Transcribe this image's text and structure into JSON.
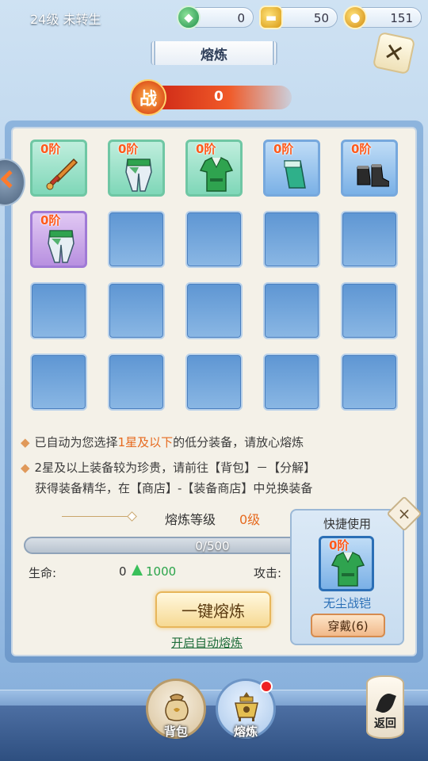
{
  "header": {
    "level_text": "24级 未转生",
    "resources": [
      {
        "icon": "jade-icon",
        "value": "0"
      },
      {
        "icon": "gold-ingot-icon",
        "value": "50"
      },
      {
        "icon": "coin-icon",
        "value": "151"
      }
    ],
    "title": "熔炼",
    "power_icon_text": "战",
    "power_value": "0"
  },
  "grid": {
    "slots": [
      {
        "state": "green",
        "tier": "0阶",
        "item": "sword-icon"
      },
      {
        "state": "green",
        "tier": "0阶",
        "item": "pants-icon"
      },
      {
        "state": "green",
        "tier": "0阶",
        "item": "armor-icon"
      },
      {
        "state": "blue",
        "tier": "0阶",
        "item": "bracer-icon"
      },
      {
        "state": "blue",
        "tier": "0阶",
        "item": "boots-icon"
      },
      {
        "state": "purple",
        "tier": "0阶",
        "item": "pants-icon"
      }
    ]
  },
  "notes": {
    "line1_pre": "已自动为您选择",
    "line1_hl": "1星及以下",
    "line1_post": "的低分装备，请放心熔炼",
    "line2": "2星及以上装备较为珍贵，请前往【背包】－【分解】",
    "line3": "获得装备精华，在【商店】-【装备商店】中兑换装备"
  },
  "smelt": {
    "level_label": "熔炼等级",
    "level_value": "0级",
    "progress_text": "0/500",
    "progress_fraction": 0,
    "hp_label": "生命:",
    "hp_value": "0",
    "hp_gain": "1000",
    "atk_label": "攻击:",
    "button": "一键熔炼",
    "auto_link": "开启自动熔炼"
  },
  "quick_use": {
    "title": "快捷使用",
    "tier": "0阶",
    "item_name": "无尘战铠",
    "wear_button": "穿戴(6)",
    "close": "×"
  },
  "bottom_nav": {
    "bag": "背包",
    "smelt": "熔炼",
    "back": "返回"
  },
  "colors": {
    "accent_orange": "#e66a1f",
    "green_gain": "#2aa44a",
    "link_green": "#1f6d3a"
  }
}
